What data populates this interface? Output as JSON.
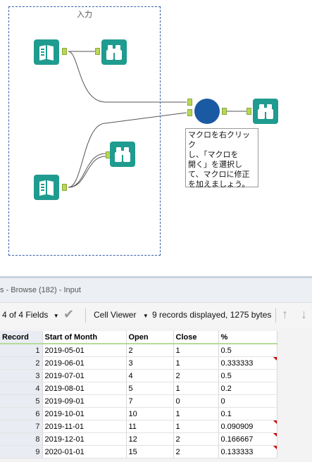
{
  "canvas": {
    "container_title": "入力",
    "note_lines": [
      "マクロを右クリック",
      "し、「マクロを",
      "開く」を選択し",
      "て、マクロに修正",
      "を加えましょう。"
    ]
  },
  "results": {
    "title": "s - Browse (182) - Input",
    "fields_label": "4 of 4 Fields",
    "viewer_label": "Cell Viewer",
    "records_info": "9 records displayed, 1275 bytes",
    "columns": [
      "Record",
      "Start of Month",
      "Open",
      "Close",
      "%"
    ],
    "rows": [
      {
        "record": "1",
        "month": "2019-05-01",
        "open": "2",
        "close": "1",
        "pct": "0.5",
        "flag": false
      },
      {
        "record": "2",
        "month": "2019-06-01",
        "open": "3",
        "close": "1",
        "pct": "0.333333",
        "flag": true
      },
      {
        "record": "3",
        "month": "2019-07-01",
        "open": "4",
        "close": "2",
        "pct": "0.5",
        "flag": false
      },
      {
        "record": "4",
        "month": "2019-08-01",
        "open": "5",
        "close": "1",
        "pct": "0.2",
        "flag": false
      },
      {
        "record": "5",
        "month": "2019-09-01",
        "open": "7",
        "close": "0",
        "pct": "0",
        "flag": false
      },
      {
        "record": "6",
        "month": "2019-10-01",
        "open": "10",
        "close": "1",
        "pct": "0.1",
        "flag": false
      },
      {
        "record": "7",
        "month": "2019-11-01",
        "open": "11",
        "close": "1",
        "pct": "0.090909",
        "flag": true
      },
      {
        "record": "8",
        "month": "2019-12-01",
        "open": "12",
        "close": "2",
        "pct": "0.166667",
        "flag": true
      },
      {
        "record": "9",
        "month": "2020-01-01",
        "open": "15",
        "close": "2",
        "pct": "0.133333",
        "flag": true
      }
    ]
  },
  "colors": {
    "tool_teal": "#1f9b8f",
    "macro_blue": "#1a5aa3",
    "anchor_green": "#b8d657",
    "container_border": "#3a5fa8"
  }
}
